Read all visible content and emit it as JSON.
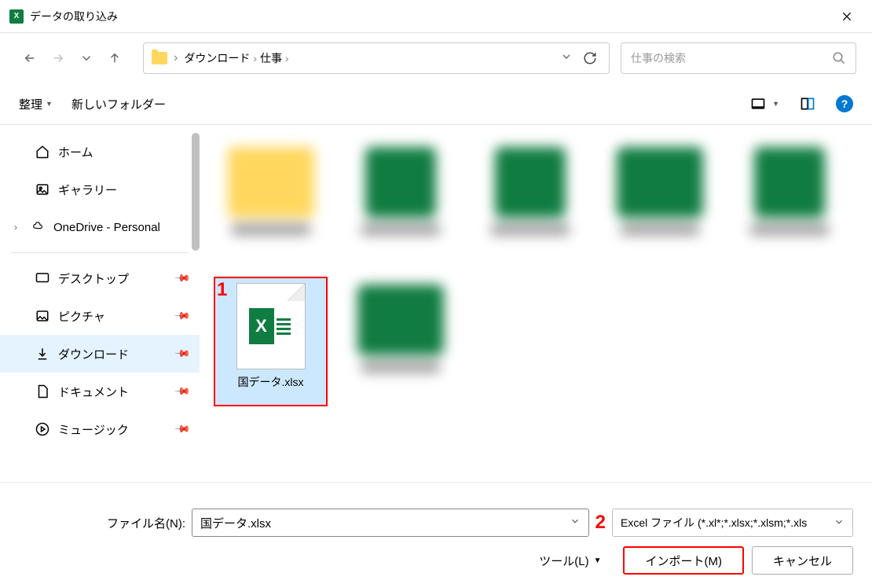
{
  "window": {
    "title": "データの取り込み"
  },
  "breadcrumb": {
    "item1": "ダウンロード",
    "item2": "仕事"
  },
  "search": {
    "placeholder": "仕事の検索"
  },
  "toolbar": {
    "organize": "整理",
    "new_folder": "新しいフォルダー"
  },
  "sidebar": {
    "home": "ホーム",
    "gallery": "ギャラリー",
    "onedrive": "OneDrive - Personal",
    "desktop": "デスクトップ",
    "pictures": "ピクチャ",
    "downloads": "ダウンロード",
    "documents": "ドキュメント",
    "music": "ミュージック"
  },
  "files": {
    "selected": {
      "name": "国データ.xlsx"
    }
  },
  "footer": {
    "filename_label": "ファイル名(N):",
    "filename_value": "国データ.xlsx",
    "filetype": "Excel ファイル (*.xl*;*.xlsx;*.xlsm;*.xls",
    "tools": "ツール(L)",
    "import": "インポート(M)",
    "cancel": "キャンセル"
  },
  "annotations": {
    "one": "1",
    "two": "2"
  }
}
